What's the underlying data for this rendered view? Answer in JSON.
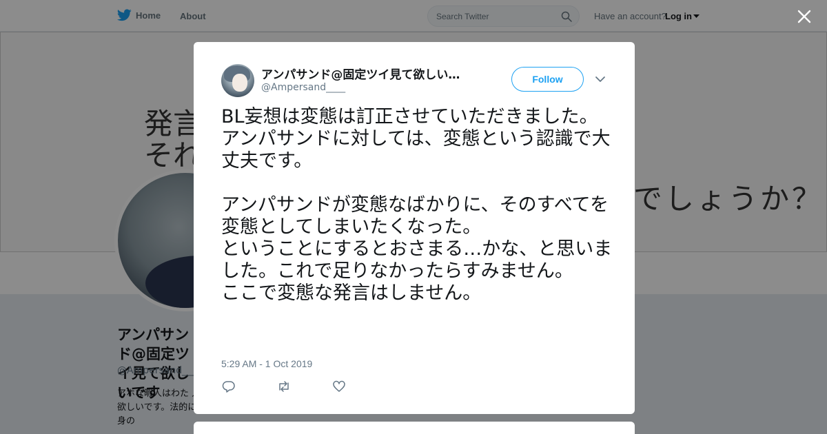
{
  "nav": {
    "home_label": "Home",
    "about_label": "About",
    "search_placeholder": "Search Twitter",
    "account_prompt": "Have an account?",
    "login_label": "Log in"
  },
  "background": {
    "banner_line_1": "発言",
    "banner_line_2": "それ",
    "banner_line_3": "でしょうか？",
    "profile_name": "アンパサンド@固定ツイ見て欲しいです",
    "profile_handle": "@Ampersand____",
    "profile_bio": "アホな暇人はわた 人に向けては言い 摘は直接欲しいです。法的に罰せられる 内容以外は自身の"
  },
  "tweet": {
    "display_name": "アンパサンド@固定ツイ見て欲しい…",
    "handle": "@Ampersand____",
    "follow_label": "Follow",
    "text": "BL妄想は変態は訂正させていただきました。\nアンパサンドに対しては、変態という認識で大丈夫です。\n\nアンパサンドが変態なばかりに、そのすべてを変態としてしまいたくなった。\nということにするとおさまる…かな、と思いました。これで足りなかったらすみません。\nここで変態な発言はしません。",
    "timestamp": "5:29 AM - 1 Oct 2019"
  },
  "icons": {
    "brand": "twitter-bird-icon",
    "search": "search-icon",
    "close": "close-icon",
    "caret": "chevron-down-icon",
    "reply": "reply-icon",
    "retweet": "retweet-icon",
    "like": "heart-icon"
  },
  "colors": {
    "accent": "#1da1f2",
    "text_primary": "#14171a",
    "text_secondary": "#657786"
  }
}
